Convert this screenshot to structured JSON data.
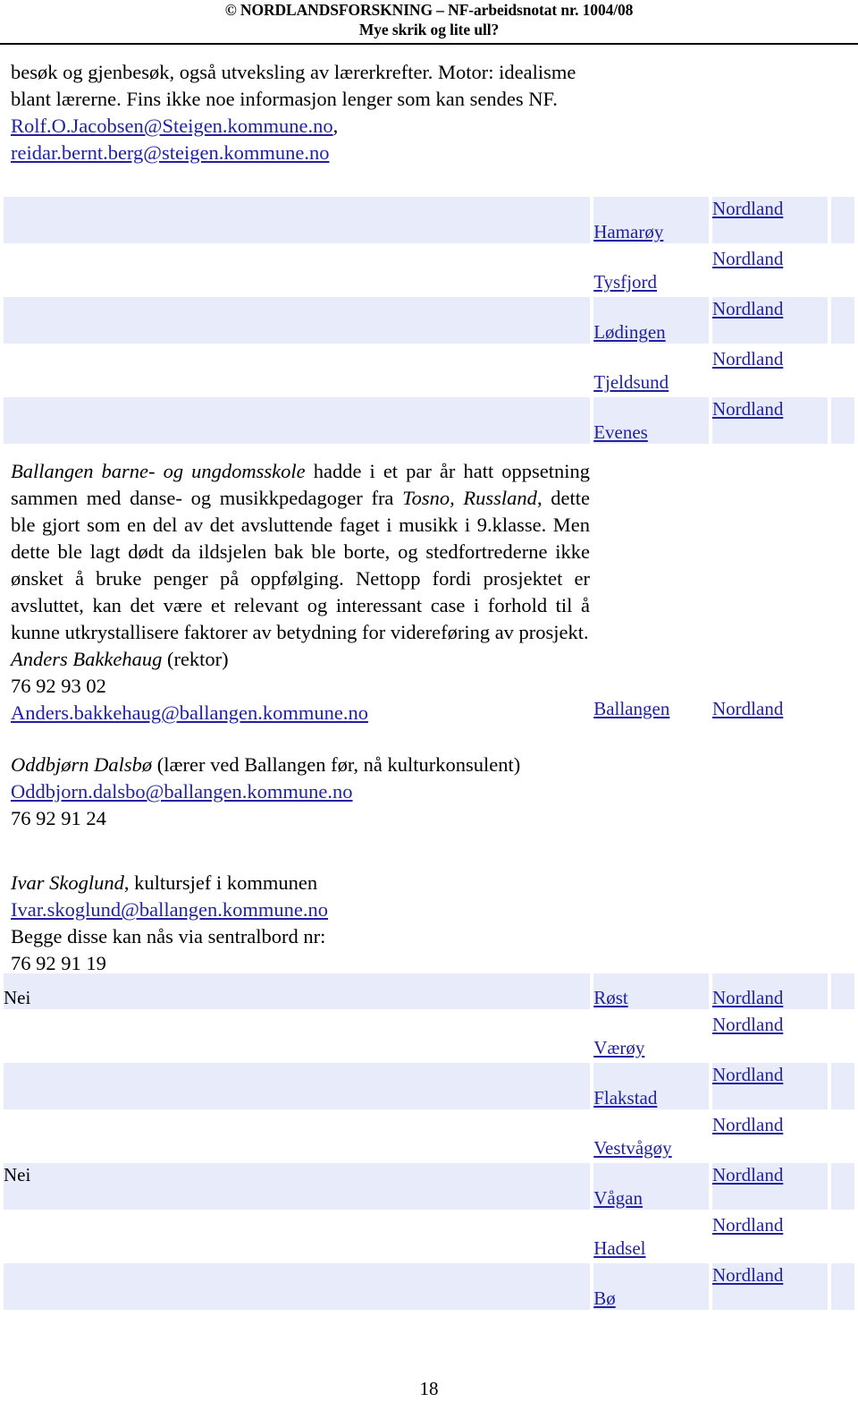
{
  "header": {
    "line1": "© NORDLANDSFORSKNING – NF-arbeidsnotat nr. 1004/08",
    "line2": "Mye skrik og lite ull?"
  },
  "intro": {
    "paragraph": "besøk og gjenbesøk, også utveksling av lærerkrefter.  Motor: idealisme blant lærerne.  Fins ikke noe informasjon lenger som kan sendes NF.",
    "email1": "Rolf.O.Jacobsen@Steigen.kommune.no",
    "email1_suffix": ",",
    "email2": "reidar.bernt.berg@steigen.kommune.no"
  },
  "ballangen": {
    "school_italic": "Ballangen barne- og ungdomsskole",
    "body_rest": " hadde i et par år hatt oppsetning sammen med danse- og musikkpedagoger fra ",
    "place_italic": "Tosno, Russland",
    "body_rest2": ", dette ble gjort som en del av det avsluttende faget i musikk i 9.klasse.  Men dette ble lagt dødt da ildsjelen bak ble borte, og stedfortrederne ikke ønsket å bruke penger på oppfølging.  Nettopp fordi prosjektet er avsluttet, kan det være et relevant og interessant case i forhold til å kunne utkrystallisere faktorer av betydning for videreføring av prosjekt.",
    "contact1_name": "Anders Bakkehaug",
    "contact1_role": " (rektor)",
    "contact1_phone": "76 92 93 02",
    "contact1_email": "Anders.bakkehaug@ballangen.kommune.no",
    "contact2_name": "Oddbjørn Dalsbø",
    "contact2_role": " (lærer ved Ballangen før, nå kulturkonsulent)",
    "contact2_email": "Oddbjorn.dalsbo@ballangen.kommune.no",
    "contact2_phone": "76 92 91 24",
    "contact3_name": "Ivar Skoglund",
    "contact3_role": ", kultursjef i kommunen",
    "contact3_email": "Ivar.skoglund@ballangen.kommune.no",
    "switchboard_label": "Begge disse kan nås via sentralbord nr:",
    "switchboard_phone": "76 92 91 19"
  },
  "table": {
    "rows": [
      {
        "note": "",
        "municipality": "Hamarøy",
        "county": "Nordland",
        "shaded": true
      },
      {
        "note": "",
        "municipality": "Tysfjord",
        "county": "Nordland",
        "shaded": false
      },
      {
        "note": "",
        "municipality": "Lødingen",
        "county": "Nordland",
        "shaded": true
      },
      {
        "note": "",
        "municipality": "Tjeldsund",
        "county": "Nordland",
        "shaded": false
      },
      {
        "note": "",
        "municipality": "Evenes",
        "county": "Nordland",
        "shaded": true
      },
      {
        "note": "",
        "municipality": "Ballangen",
        "county": "Nordland",
        "shaded": false
      },
      {
        "note": "Nei",
        "municipality": "Røst",
        "county": "Nordland",
        "shaded": true
      },
      {
        "note": "",
        "municipality": "Værøy",
        "county": "Nordland",
        "shaded": false
      },
      {
        "note": "",
        "municipality": "Flakstad",
        "county": "Nordland",
        "shaded": true
      },
      {
        "note": "",
        "municipality": "Vestvågøy",
        "county": "Nordland",
        "shaded": false
      },
      {
        "note": "Nei",
        "municipality": "Vågan",
        "county": "Nordland",
        "shaded": true
      },
      {
        "note": "",
        "municipality": "Hadsel",
        "county": "Nordland",
        "shaded": false
      },
      {
        "note": "",
        "municipality": "Bø",
        "county": "Nordland",
        "shaded": true
      }
    ]
  },
  "folio": {
    "page_number": "18"
  },
  "colors": {
    "link": "#2222A0",
    "row_shade": "#E7EBFA",
    "text": "#000000"
  }
}
